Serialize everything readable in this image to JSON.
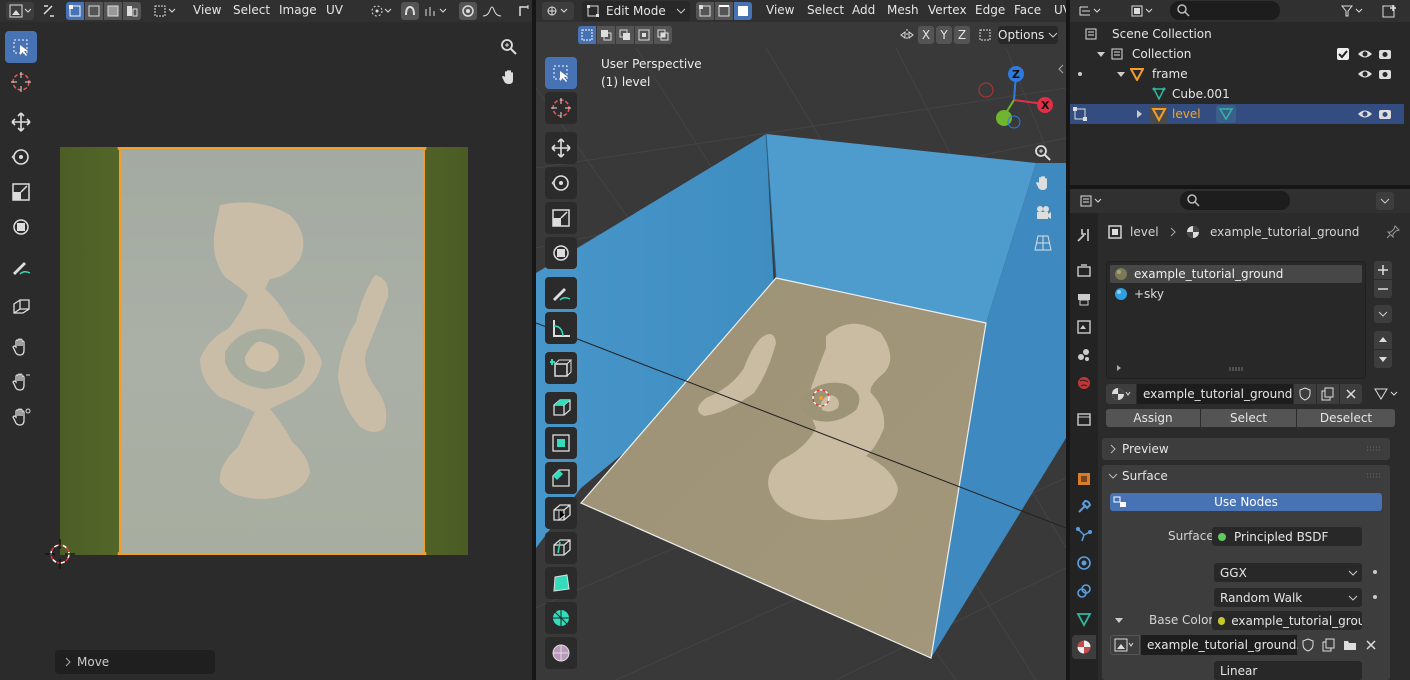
{
  "uv_editor": {
    "menus": [
      "View",
      "Select",
      "Image",
      "UV"
    ],
    "last_operator": "Move"
  },
  "viewport": {
    "mode": "Edit Mode",
    "menus": [
      "View",
      "Select",
      "Add",
      "Mesh",
      "Vertex",
      "Edge",
      "Face",
      "UV"
    ],
    "overlay_title": "User Perspective",
    "overlay_object": "(1) level",
    "axis_x": "X",
    "axis_y": "Y",
    "axis_z": "Z",
    "options_label": "Options"
  },
  "outliner": {
    "items": [
      {
        "label": "Scene Collection"
      },
      {
        "label": "Collection"
      },
      {
        "label": "frame"
      },
      {
        "label": "Cube.001"
      },
      {
        "label": "level"
      }
    ]
  },
  "properties": {
    "breadcrumb_object": "level",
    "breadcrumb_material": "example_tutorial_ground",
    "slots": [
      "example_tutorial_ground",
      "+sky"
    ],
    "material_name": "example_tutorial_ground",
    "assign_label": "Assign",
    "select_label": "Select",
    "deselect_label": "Deselect",
    "preview_label": "Preview",
    "surface_panel_label": "Surface",
    "use_nodes_label": "Use Nodes",
    "surface_field_label": "Surface",
    "surface_value": "Principled BSDF",
    "distribution_value": "GGX",
    "subsurface_value": "Random Walk",
    "base_color_label": "Base Color",
    "base_color_value": "example_tutorial_grou...",
    "image_name": "example_tutorial_ground.tif",
    "colorspace_value": "Linear"
  },
  "colors": {
    "accent": "#4772b3",
    "selection_orange": "#f29d2c",
    "wall_blue": "#4a95c8",
    "header_bg": "#303030",
    "panel_bg": "#3d3d3d"
  }
}
